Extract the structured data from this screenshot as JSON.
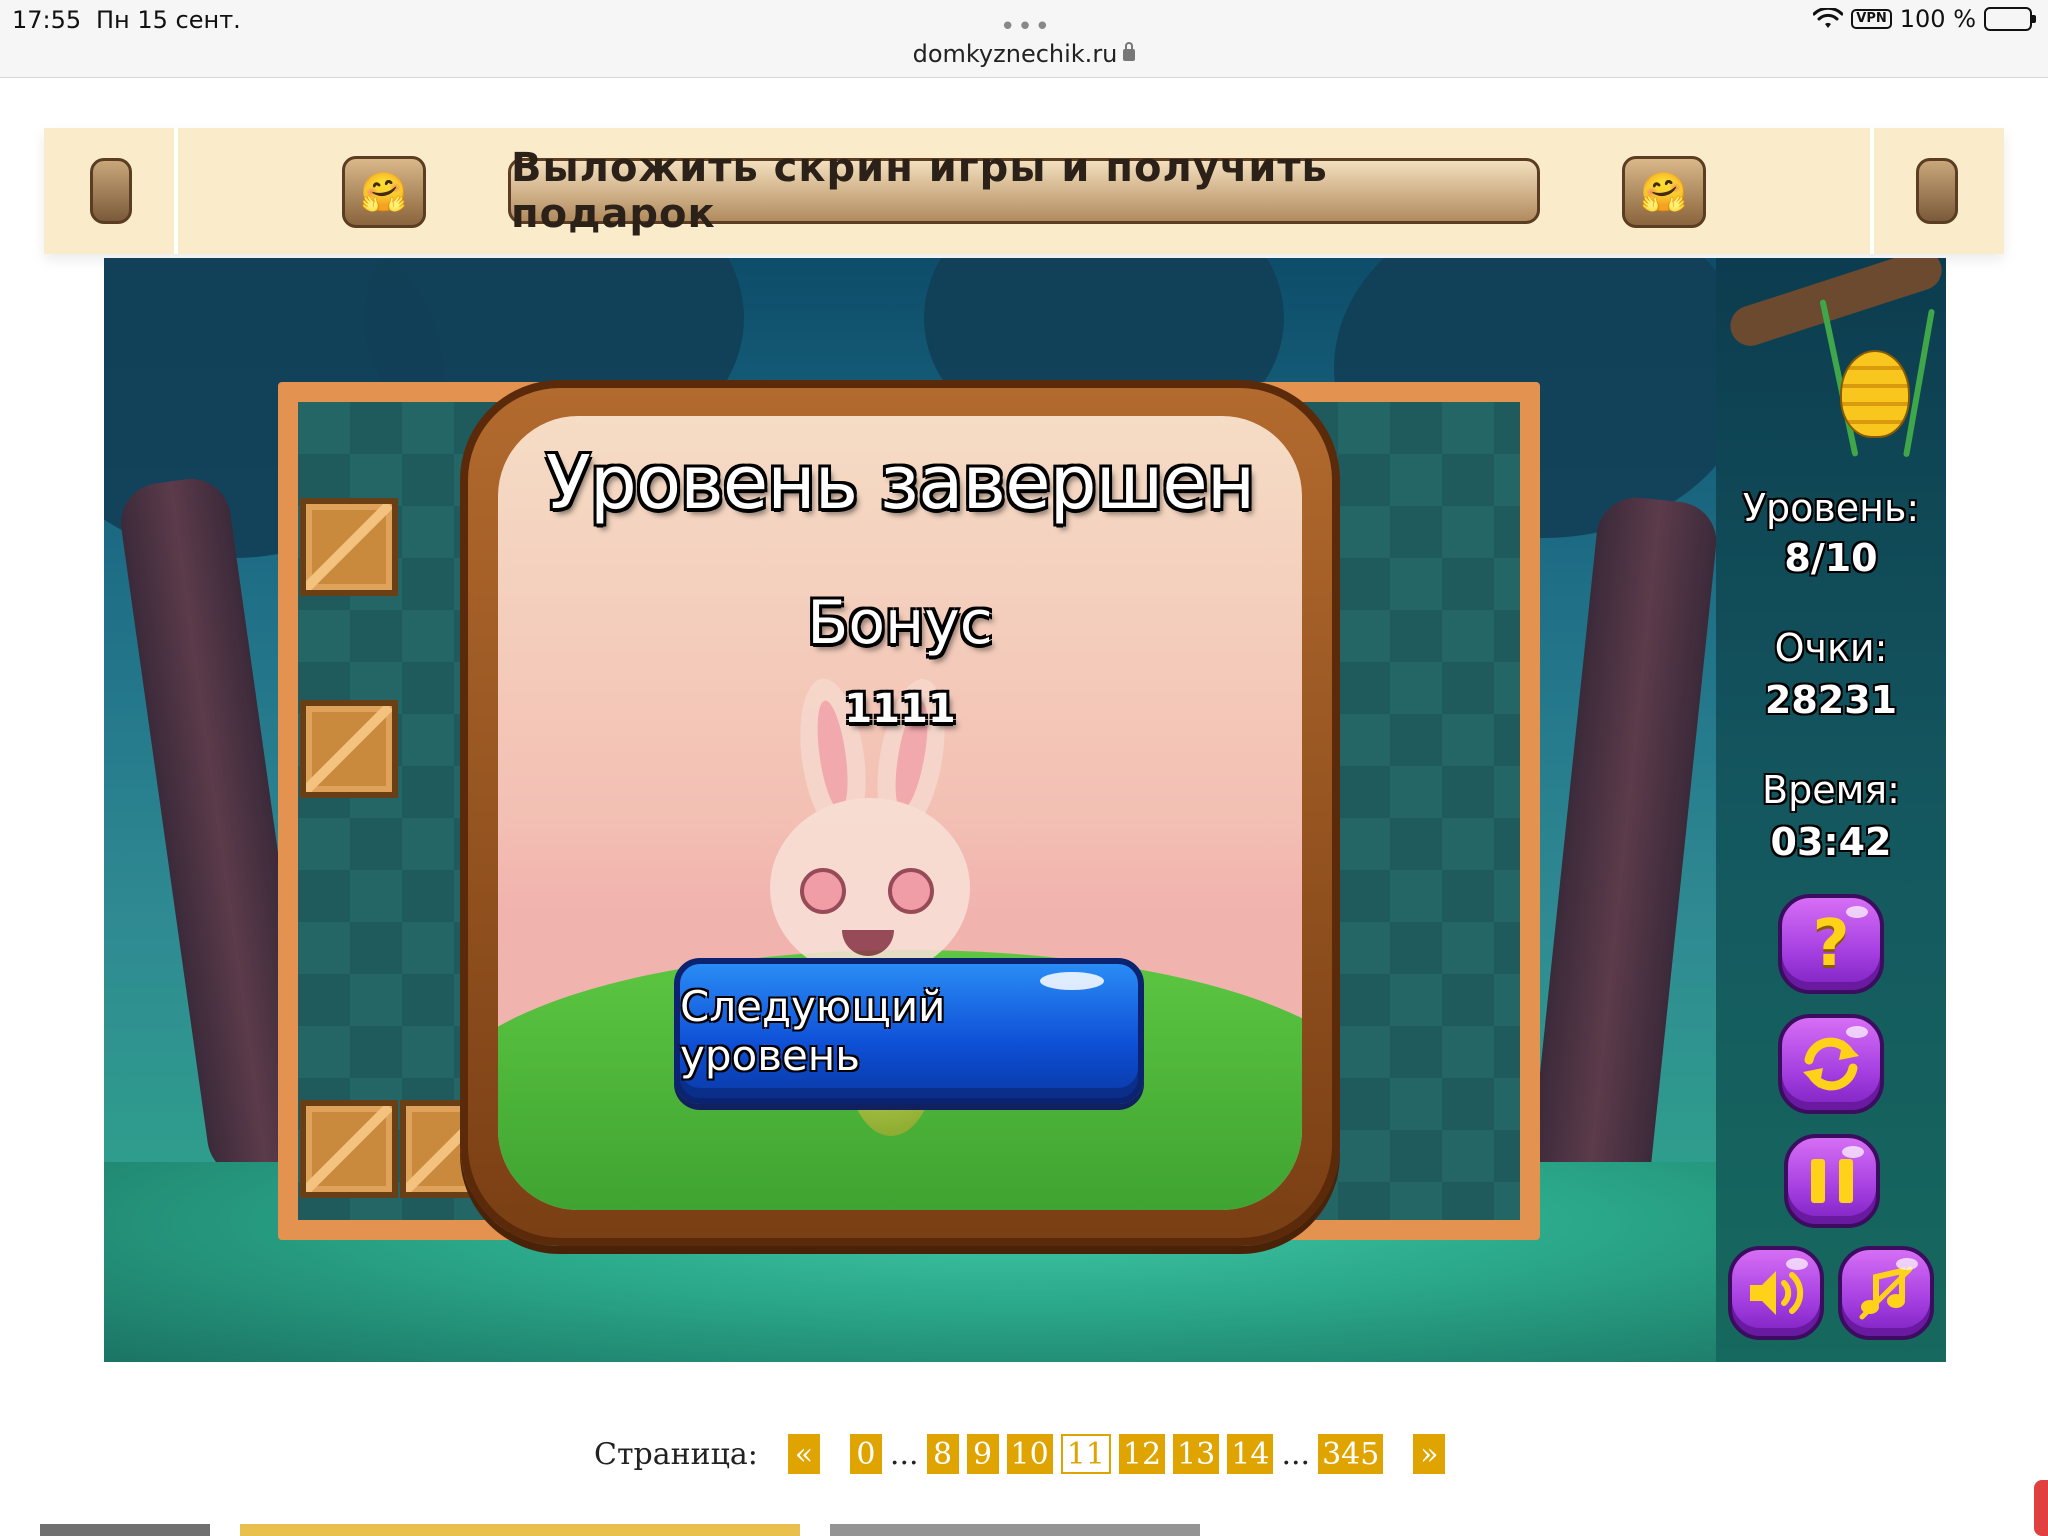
{
  "status_bar": {
    "time": "17:55",
    "date": "Пн 15 сент.",
    "url": "domkyznechik.ru",
    "vpn": "VPN",
    "battery": "100 %"
  },
  "banner": {
    "promo_text": "Выложить скрин игры и получить подарок",
    "emoji": "🤗"
  },
  "game": {
    "dialog": {
      "title": "Уровень завершен",
      "bonus_label": "Бонус",
      "bonus_value": "1111",
      "next_button": "Следующий уровень"
    },
    "stats": {
      "level_label": "Уровень:",
      "level_value": "8/10",
      "score_label": "Очки:",
      "score_value": "28231",
      "time_label": "Время:",
      "time_value": "03:42"
    },
    "buttons": {
      "help": "?",
      "restart_icon": "restart-icon",
      "pause_icon": "pause-icon",
      "sound_icon": "sound-icon",
      "music_off_icon": "music-off-icon"
    }
  },
  "pagination": {
    "label": "Страница:",
    "prev": "«",
    "first": "0",
    "ellipsis": "...",
    "pages": [
      "8",
      "9",
      "10",
      "11",
      "12",
      "13",
      "14"
    ],
    "current": "11",
    "last": "345",
    "next": "»"
  },
  "colors": {
    "accent": "#e0a400",
    "banner_bg": "#faeccb",
    "next_button": "#1565e6",
    "purple_button": "#a43ee0"
  }
}
